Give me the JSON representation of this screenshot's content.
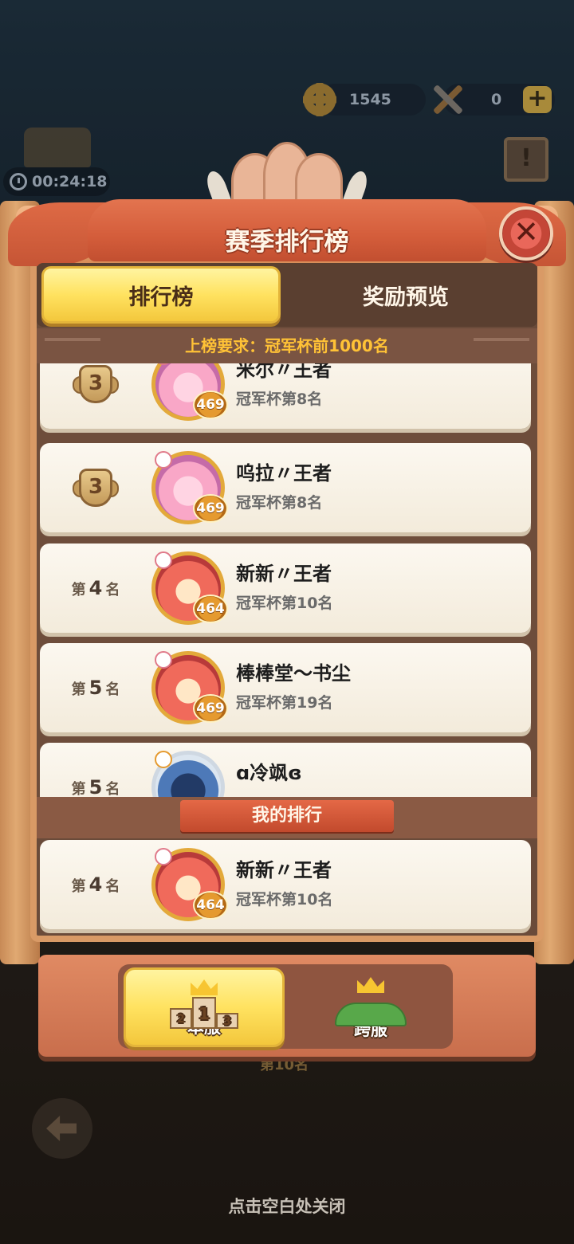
{
  "hud": {
    "gears": "1545",
    "tools": "0",
    "timer": "00:24:18"
  },
  "panel": {
    "title": "赛季排行榜",
    "close_glyph": "✕",
    "tabs": [
      {
        "label": "排行榜",
        "active": true
      },
      {
        "label": "奖励预览",
        "active": false
      }
    ],
    "requirement": "上榜要求：冠军杯前1000名"
  },
  "leaderboard": [
    {
      "rank_medal": "3",
      "name": "米尔〃王者",
      "detail": "冠军杯第8名",
      "level": "469",
      "avatar": "pink"
    },
    {
      "rank_medal": "3",
      "name": "呜拉〃王者",
      "detail": "冠军杯第8名",
      "level": "469",
      "avatar": "pink"
    },
    {
      "rank_prefix": "第",
      "rank": "4",
      "rank_suffix": "名",
      "name": "新新〃王者",
      "detail": "冠军杯第10名",
      "level": "464",
      "avatar": "red"
    },
    {
      "rank_prefix": "第",
      "rank": "5",
      "rank_suffix": "名",
      "name": "棒棒堂〜书尘",
      "detail": "冠军杯第19名",
      "level": "469",
      "avatar": "red"
    },
    {
      "rank_prefix": "第",
      "rank": "5",
      "rank_suffix": "名",
      "name": "ɑ冷飒ɞ",
      "detail": "",
      "level": "",
      "avatar": "blue"
    }
  ],
  "my_rank": {
    "header": "我的排行",
    "rank_prefix": "第",
    "rank": "4",
    "rank_suffix": "名",
    "name": "新新〃王者",
    "detail": "冠军杯第10名",
    "level": "464"
  },
  "server_tabs": [
    {
      "label": "本服",
      "active": true,
      "podium_digits": [
        "2",
        "1",
        "3"
      ]
    },
    {
      "label": "跨服",
      "active": false
    }
  ],
  "background_text": "第10名",
  "close_hint": "点击空白处关闭"
}
